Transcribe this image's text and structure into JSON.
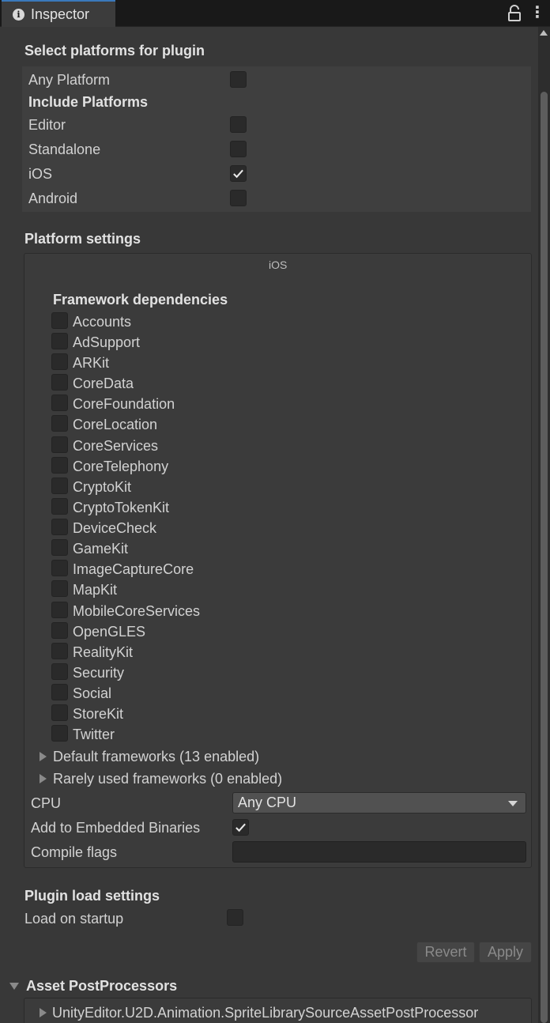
{
  "window": {
    "tab_title": "Inspector"
  },
  "platforms": {
    "section_title": "Select platforms for plugin",
    "any_platform": {
      "label": "Any Platform",
      "checked": false
    },
    "include_title": "Include Platforms",
    "items": [
      {
        "label": "Editor",
        "checked": false
      },
      {
        "label": "Standalone",
        "checked": false
      },
      {
        "label": "iOS",
        "checked": true
      },
      {
        "label": "Android",
        "checked": false
      }
    ]
  },
  "platform_settings": {
    "section_title": "Platform settings",
    "tab_label": "iOS",
    "framework_title": "Framework dependencies",
    "frameworks": [
      {
        "label": "Accounts",
        "checked": false
      },
      {
        "label": "AdSupport",
        "checked": false
      },
      {
        "label": "ARKit",
        "checked": false
      },
      {
        "label": "CoreData",
        "checked": false
      },
      {
        "label": "CoreFoundation",
        "checked": false
      },
      {
        "label": "CoreLocation",
        "checked": false
      },
      {
        "label": "CoreServices",
        "checked": false
      },
      {
        "label": "CoreTelephony",
        "checked": false
      },
      {
        "label": "CryptoKit",
        "checked": false
      },
      {
        "label": "CryptoTokenKit",
        "checked": false
      },
      {
        "label": "DeviceCheck",
        "checked": false
      },
      {
        "label": "GameKit",
        "checked": false
      },
      {
        "label": "ImageCaptureCore",
        "checked": false
      },
      {
        "label": "MapKit",
        "checked": false
      },
      {
        "label": "MobileCoreServices",
        "checked": false
      },
      {
        "label": "OpenGLES",
        "checked": false
      },
      {
        "label": "RealityKit",
        "checked": false
      },
      {
        "label": "Security",
        "checked": false
      },
      {
        "label": "Social",
        "checked": false
      },
      {
        "label": "StoreKit",
        "checked": false
      },
      {
        "label": "Twitter",
        "checked": false
      }
    ],
    "default_frameworks": "Default frameworks (13 enabled)",
    "rare_frameworks": "Rarely used frameworks (0 enabled)",
    "cpu": {
      "label": "CPU",
      "value": "Any CPU"
    },
    "embedded": {
      "label": "Add to Embedded Binaries",
      "checked": true
    },
    "compile_flags": {
      "label": "Compile flags",
      "value": ""
    }
  },
  "load_settings": {
    "section_title": "Plugin load settings",
    "load_on_startup": {
      "label": "Load on startup",
      "checked": false
    }
  },
  "buttons": {
    "revert": "Revert",
    "apply": "Apply"
  },
  "postprocessors": {
    "title": "Asset PostProcessors",
    "items": [
      "UnityEditor.U2D.Animation.SpriteLibrarySourceAssetPostProcessor"
    ]
  },
  "icons": {
    "tab": "info-icon",
    "lock": "lock-icon",
    "menu": "kebab-menu-icon",
    "check": "checkmark-icon",
    "foldout_closed": "triangle-right-icon",
    "foldout_open": "triangle-down-icon",
    "dropdown": "caret-down-icon"
  },
  "colors": {
    "accent": "#3a79bb",
    "panel": "#383838",
    "field": "#2a2a2a"
  }
}
